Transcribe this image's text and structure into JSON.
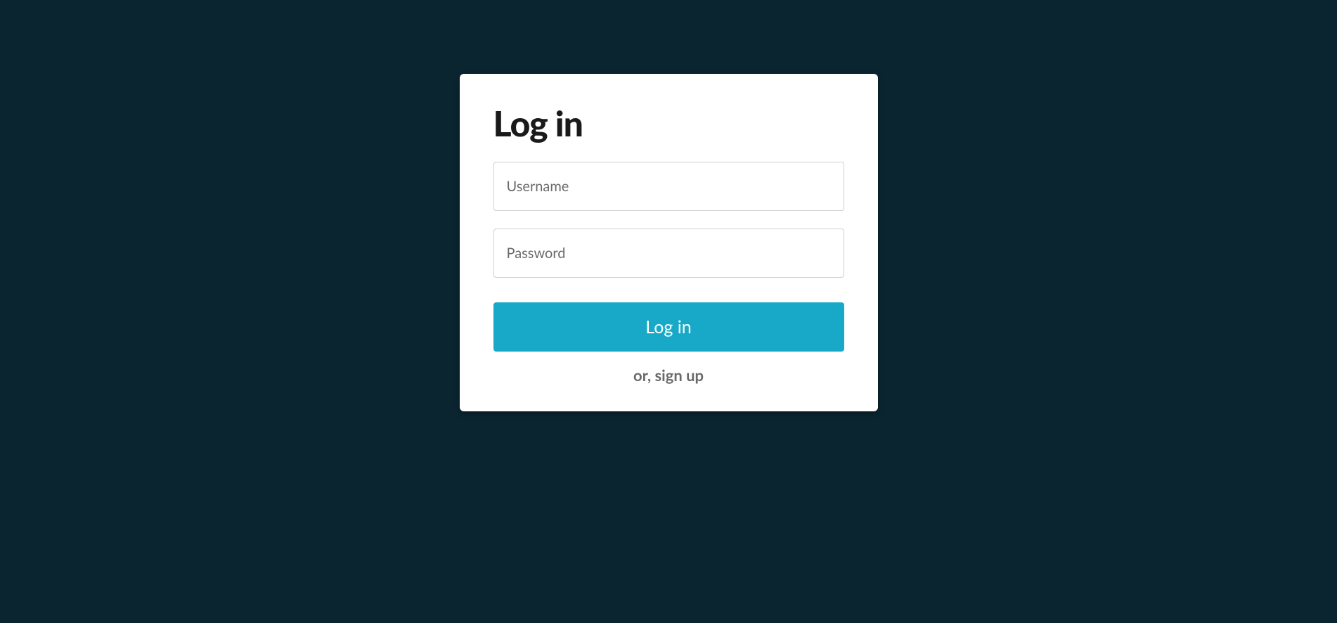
{
  "login": {
    "title": "Log in",
    "username_placeholder": "Username",
    "password_placeholder": "Password",
    "submit_label": "Log in",
    "signup_text": "or, sign up"
  }
}
